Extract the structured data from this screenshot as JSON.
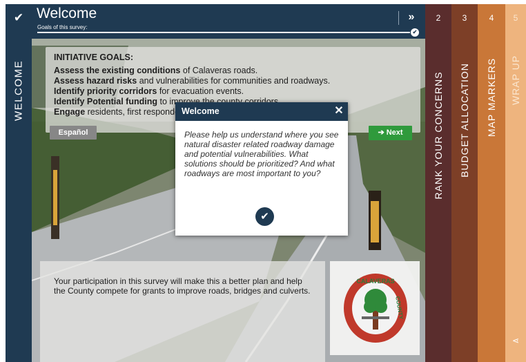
{
  "header": {
    "title": "Welcome",
    "subtitle": "Goals of this survey:",
    "progress": 1.0
  },
  "left_tab": {
    "label": "WELCOME",
    "check_icon": "check-icon"
  },
  "goals": {
    "heading": "INITIATIVE GOALS:",
    "items": [
      {
        "bold": "Assess the existing conditions",
        "rest": " of Calaveras roads."
      },
      {
        "bold": "Assess hazard risks",
        "rest": " and vulnerabilities for communities and roadways."
      },
      {
        "bold": "Identify priority corridors",
        "rest": " for evacuation events."
      },
      {
        "bold": "Identify Potential funding",
        "rest": " to improve the county corridors."
      },
      {
        "bold": "Engage",
        "rest": " residents, first responders, local agencies, tribes, and Caltrans."
      }
    ]
  },
  "buttons": {
    "espanol": "Español",
    "next": "➔ Next"
  },
  "info_text": "Your participation in this survey will make this a better plan and help the County compete for grants to improve roads, bridges and culverts.",
  "modal": {
    "title": "Welcome",
    "body": "Please help us understand where you see natural disaster related roadway damage and potential vulnerabilities. What solutions should be prioritized? And what roadways are most important to you?"
  },
  "logo": {
    "text_top": "CALAVERAS",
    "text_right": "COUNTY"
  },
  "steps": [
    {
      "num": "2",
      "label": "RANK YOUR CONCERNS",
      "color": "#5a2d2d"
    },
    {
      "num": "3",
      "label": "BUDGET ALLOCATION",
      "color": "#7d3f27"
    },
    {
      "num": "4",
      "label": "MAP MARKERS",
      "color": "#c97738"
    },
    {
      "num": "5",
      "label": "WRAP UP",
      "color": "#eeb47e"
    }
  ],
  "colors": {
    "navy": "#1f3a52",
    "green": "#2f9a3c"
  }
}
